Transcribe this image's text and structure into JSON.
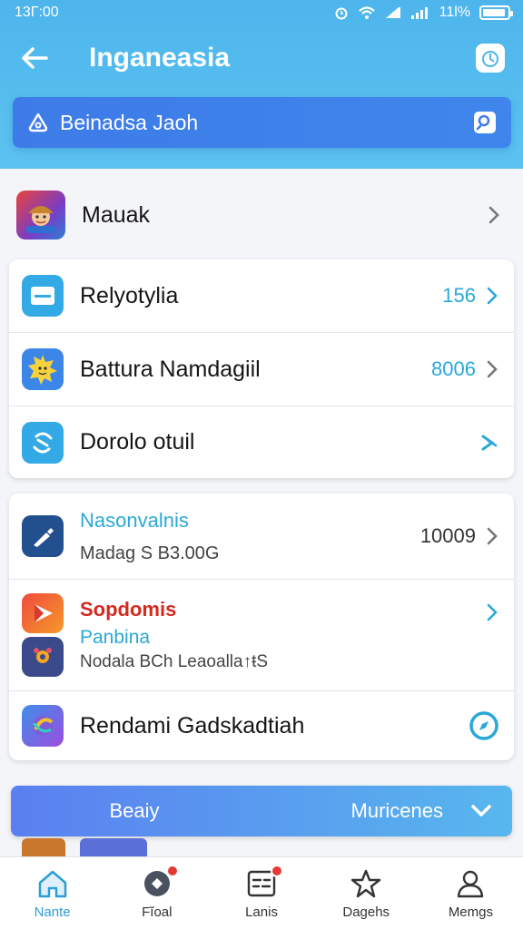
{
  "status": {
    "time": "13Г:00",
    "battery": "11l%"
  },
  "header": {
    "title": "Inganeasia"
  },
  "search": {
    "text": "Beinadsa Jaoh"
  },
  "rows": {
    "top": {
      "label": "Mauak"
    },
    "r1": {
      "label": "Relyotylia",
      "value": "156"
    },
    "r2": {
      "label": "Battura Namdagiil",
      "value": "8006"
    },
    "r3": {
      "label": "Dorolo otuil"
    },
    "r4": {
      "title": "Nasonvalnis",
      "subtitle": "Madag S B3.00G",
      "value": "10009"
    },
    "r5": {
      "title": "Sopdomis",
      "subtitle": "Panbina",
      "detail": "Nodala BCh Leaoalla↑ŧS"
    },
    "r6": {
      "label": "Rendami Gadskadtiah"
    }
  },
  "banner": {
    "left": "Beaiy",
    "right": "Muricenes"
  },
  "nav": [
    {
      "label": "Nante",
      "icon": "home-icon"
    },
    {
      "label": "Fĭoal",
      "icon": "chat-icon"
    },
    {
      "label": "Lanis",
      "icon": "list-icon"
    },
    {
      "label": "Dagehs",
      "icon": "star-icon"
    },
    {
      "label": "Memgs",
      "icon": "person-icon"
    }
  ],
  "colors": {
    "accent": "#2aa8d8",
    "header": "#4db5ec",
    "search": "#3e7be8",
    "alert": "#e53935"
  }
}
